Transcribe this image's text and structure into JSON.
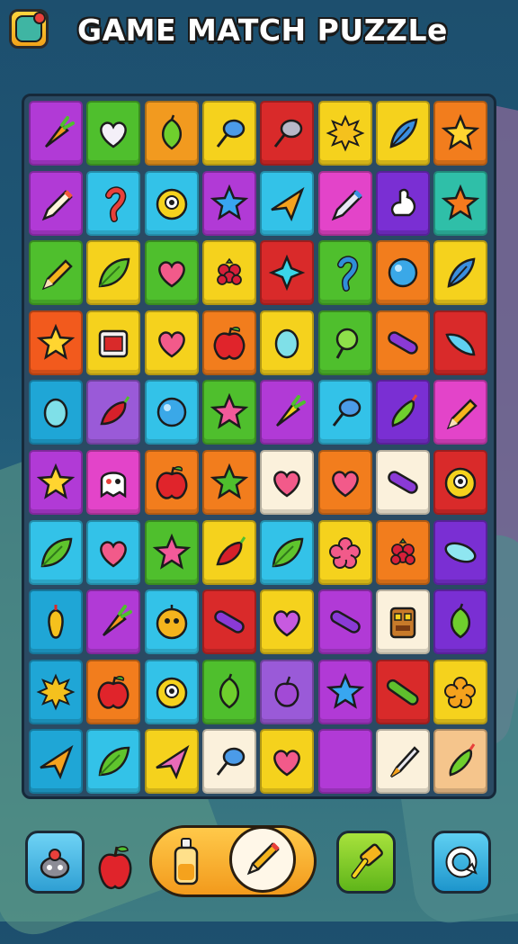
{
  "header": {
    "title": "GAME MATCH PUZZLe",
    "app_icon": "game-app-icon"
  },
  "board": {
    "rows": 10,
    "cols": 8,
    "tiles": [
      [
        {
          "bg": "#b13ad6",
          "icon": "carrot"
        },
        {
          "bg": "#4fbf2d",
          "icon": "heart-white"
        },
        {
          "bg": "#f29a1f",
          "icon": "lime"
        },
        {
          "bg": "#f5d21d",
          "icon": "balloon-blue"
        },
        {
          "bg": "#d92a2a",
          "icon": "lollipop-gray"
        },
        {
          "bg": "#f5d21d",
          "icon": "burst-yellow"
        },
        {
          "bg": "#f5d21d",
          "icon": "feather-blue"
        },
        {
          "bg": "#f27d1d",
          "icon": "star-yellow"
        }
      ],
      [
        {
          "bg": "#b13ad6",
          "icon": "pencil-white"
        },
        {
          "bg": "#33c2e8",
          "icon": "hook-red"
        },
        {
          "bg": "#33c2e8",
          "icon": "monster-yellow"
        },
        {
          "bg": "#b13ad6",
          "icon": "star-blue"
        },
        {
          "bg": "#33c2e8",
          "icon": "paper-plane"
        },
        {
          "bg": "#e344c9",
          "icon": "pencil-blue"
        },
        {
          "bg": "#7a2fd3",
          "icon": "blob-white"
        },
        {
          "bg": "#2fbfa8",
          "icon": "star-orange"
        }
      ],
      [
        {
          "bg": "#4fbf2d",
          "icon": "pencil-orange"
        },
        {
          "bg": "#f5d21d",
          "icon": "leaf-green"
        },
        {
          "bg": "#4fbf2d",
          "icon": "heart-pink"
        },
        {
          "bg": "#f5d21d",
          "icon": "raspberry"
        },
        {
          "bg": "#d92a2a",
          "icon": "star4-cyan"
        },
        {
          "bg": "#4fbf2d",
          "icon": "hook-blue"
        },
        {
          "bg": "#f27d1d",
          "icon": "orb-blue"
        },
        {
          "bg": "#f5d21d",
          "icon": "feather-blue"
        }
      ],
      [
        {
          "bg": "#f25a1d",
          "icon": "star-yellow"
        },
        {
          "bg": "#f5d21d",
          "icon": "tv-box"
        },
        {
          "bg": "#f5d21d",
          "icon": "heart-pink"
        },
        {
          "bg": "#f27d1d",
          "icon": "apple-red"
        },
        {
          "bg": "#f5d21d",
          "icon": "egg-cyan"
        },
        {
          "bg": "#4fbf2d",
          "icon": "lollipop-green"
        },
        {
          "bg": "#f27d1d",
          "icon": "pill-purple"
        },
        {
          "bg": "#d92a2a",
          "icon": "fish-cyan"
        }
      ],
      [
        {
          "bg": "#1fa6d6",
          "icon": "egg-cyan"
        },
        {
          "bg": "#9a5ad8",
          "icon": "chili-red"
        },
        {
          "bg": "#33c2e8",
          "icon": "orb-blue"
        },
        {
          "bg": "#4fbf2d",
          "icon": "star-pink"
        },
        {
          "bg": "#b13ad6",
          "icon": "carrot-yellow"
        },
        {
          "bg": "#33c2e8",
          "icon": "balloon-blue"
        },
        {
          "bg": "#7a2fd3",
          "icon": "pepper-green"
        },
        {
          "bg": "#e344c9",
          "icon": "pencil-orange"
        }
      ],
      [
        {
          "bg": "#b13ad6",
          "icon": "star-yellow"
        },
        {
          "bg": "#e344c9",
          "icon": "ghost-white"
        },
        {
          "bg": "#f27d1d",
          "icon": "apple-red"
        },
        {
          "bg": "#f27d1d",
          "icon": "star-green"
        },
        {
          "bg": "#fbf1dc",
          "icon": "heart-pink"
        },
        {
          "bg": "#f27d1d",
          "icon": "heart-pink"
        },
        {
          "bg": "#fbf1dc",
          "icon": "pill-purple"
        },
        {
          "bg": "#d92a2a",
          "icon": "monster-yellow"
        }
      ],
      [
        {
          "bg": "#33c2e8",
          "icon": "leaf-green"
        },
        {
          "bg": "#33c2e8",
          "icon": "heart-pink"
        },
        {
          "bg": "#4fbf2d",
          "icon": "star-pink"
        },
        {
          "bg": "#f5d21d",
          "icon": "chili-red"
        },
        {
          "bg": "#33c2e8",
          "icon": "leaf-green"
        },
        {
          "bg": "#f5d21d",
          "icon": "flower-pink"
        },
        {
          "bg": "#f27d1d",
          "icon": "raspberry"
        },
        {
          "bg": "#7a2fd3",
          "icon": "pill-cyan"
        }
      ],
      [
        {
          "bg": "#1fa6d6",
          "icon": "pepper-yellow"
        },
        {
          "bg": "#b13ad6",
          "icon": "carrot"
        },
        {
          "bg": "#33c2e8",
          "icon": "monster-orange"
        },
        {
          "bg": "#d92a2a",
          "icon": "pill-purple"
        },
        {
          "bg": "#f5d21d",
          "icon": "heart-purple"
        },
        {
          "bg": "#b13ad6",
          "icon": "pill-purple"
        },
        {
          "bg": "#fbf1dc",
          "icon": "totem"
        },
        {
          "bg": "#7a2fd3",
          "icon": "lime"
        }
      ],
      [
        {
          "bg": "#1fa6d6",
          "icon": "burst-yellow"
        },
        {
          "bg": "#f27d1d",
          "icon": "apple-red"
        },
        {
          "bg": "#33c2e8",
          "icon": "monster-yellow"
        },
        {
          "bg": "#4fbf2d",
          "icon": "lime"
        },
        {
          "bg": "#9a5ad8",
          "icon": "grape"
        },
        {
          "bg": "#b13ad6",
          "icon": "star-blue"
        },
        {
          "bg": "#d92a2a",
          "icon": "cucumber"
        },
        {
          "bg": "#f5d21d",
          "icon": "flower-orange"
        }
      ],
      [
        {
          "bg": "#1fa6d6",
          "icon": "paper-plane"
        },
        {
          "bg": "#33c2e8",
          "icon": "leaf-green"
        },
        {
          "bg": "#f5d21d",
          "icon": "paper-plane-pink"
        },
        {
          "bg": "#fbf1dc",
          "icon": "balloon-blue"
        },
        {
          "bg": "#f5d21d",
          "icon": "heart-pink"
        },
        {
          "bg": "#b13ad6",
          "icon": "empty"
        },
        {
          "bg": "#fbf1dc",
          "icon": "pen"
        },
        {
          "bg": "#f5c58c",
          "icon": "pepper-green"
        }
      ]
    ]
  },
  "bottom_bar": {
    "left_button_icon": "bomb-icon",
    "apple_icon": "apple-icon",
    "bottle_icon": "bottle-icon",
    "pencil_icon": "pencil-icon",
    "hammer_icon": "hammer-icon",
    "refresh_icon": "refresh-icon"
  }
}
